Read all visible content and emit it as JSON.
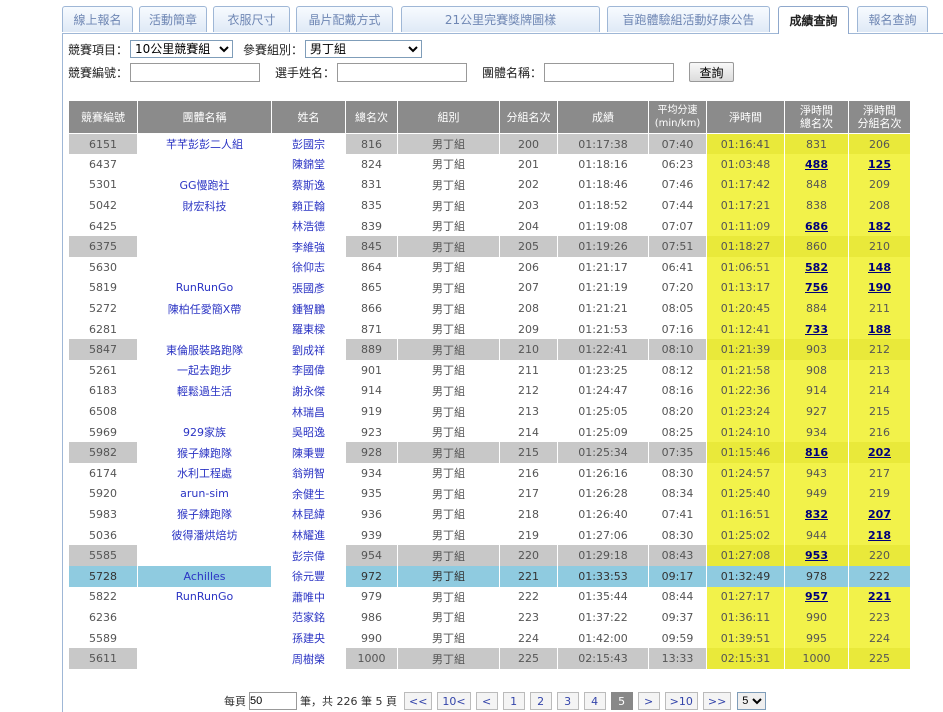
{
  "tabs": [
    "線上報名",
    "活動簡章",
    "衣服尺寸",
    "晶片配戴方式",
    "21公里完賽獎牌圖樣",
    "盲跑體驗組活動好康公告",
    "成績查詢",
    "報名查詢"
  ],
  "filters": {
    "event_label": "競賽項目：",
    "event_value": "10公里競賽組",
    "group_label": "參賽組別：",
    "group_value": "男丁組",
    "bib_label": "競賽編號：",
    "name_label": "選手姓名：",
    "team_label": "團體名稱：",
    "query_button": "查詢"
  },
  "table": {
    "headers": [
      "競賽編號",
      "團體名稱",
      "姓名",
      "總名次",
      "組別",
      "分組名次",
      "成績",
      "平均分速\n(min/km)",
      "淨時間",
      "淨時間\n總名次",
      "淨時間\n分組名次"
    ],
    "rows": [
      {
        "bib": "6151",
        "team": "芊芊彭彭二人組",
        "name": "彭國宗",
        "overall": "816",
        "group": "男丁組",
        "grank": "200",
        "result": "01:17:38",
        "pace": "07:40",
        "net": "01:16:41",
        "net_overall": "831",
        "net_grank": "206",
        "style": "gray"
      },
      {
        "bib": "6437",
        "team": "",
        "name": "陳錦堂",
        "overall": "824",
        "group": "男丁組",
        "grank": "201",
        "result": "01:18:16",
        "pace": "06:23",
        "net": "01:03:48",
        "net_overall": "488",
        "net_grank": "125",
        "style": "",
        "link": true
      },
      {
        "bib": "5301",
        "team": "GG慢跑社",
        "name": "蔡斯逸",
        "overall": "831",
        "group": "男丁組",
        "grank": "202",
        "result": "01:18:46",
        "pace": "07:46",
        "net": "01:17:42",
        "net_overall": "848",
        "net_grank": "209",
        "style": ""
      },
      {
        "bib": "5042",
        "team": "財宏科技",
        "name": "賴正翰",
        "overall": "835",
        "group": "男丁組",
        "grank": "203",
        "result": "01:18:52",
        "pace": "07:44",
        "net": "01:17:21",
        "net_overall": "838",
        "net_grank": "208",
        "style": ""
      },
      {
        "bib": "6425",
        "team": "",
        "name": "林浩德",
        "overall": "839",
        "group": "男丁組",
        "grank": "204",
        "result": "01:19:08",
        "pace": "07:07",
        "net": "01:11:09",
        "net_overall": "686",
        "net_grank": "182",
        "style": "",
        "link": true
      },
      {
        "bib": "6375",
        "team": "",
        "name": "李維強",
        "overall": "845",
        "group": "男丁組",
        "grank": "205",
        "result": "01:19:26",
        "pace": "07:51",
        "net": "01:18:27",
        "net_overall": "860",
        "net_grank": "210",
        "style": "gray"
      },
      {
        "bib": "5630",
        "team": "",
        "name": "徐仰志",
        "overall": "864",
        "group": "男丁組",
        "grank": "206",
        "result": "01:21:17",
        "pace": "06:41",
        "net": "01:06:51",
        "net_overall": "582",
        "net_grank": "148",
        "style": "",
        "link": true
      },
      {
        "bib": "5819",
        "team": "RunRunGo",
        "name": "張國彥",
        "overall": "865",
        "group": "男丁組",
        "grank": "207",
        "result": "01:21:19",
        "pace": "07:20",
        "net": "01:13:17",
        "net_overall": "756",
        "net_grank": "190",
        "style": "",
        "link": true
      },
      {
        "bib": "5272",
        "team": "陳柏任愛簡X帶",
        "name": "鍾智鵬",
        "overall": "866",
        "group": "男丁組",
        "grank": "208",
        "result": "01:21:21",
        "pace": "08:05",
        "net": "01:20:45",
        "net_overall": "884",
        "net_grank": "211",
        "style": ""
      },
      {
        "bib": "6281",
        "team": "",
        "name": "羅東樑",
        "overall": "871",
        "group": "男丁組",
        "grank": "209",
        "result": "01:21:53",
        "pace": "07:16",
        "net": "01:12:41",
        "net_overall": "733",
        "net_grank": "188",
        "style": "",
        "link": true
      },
      {
        "bib": "5847",
        "team": "東倫服裝路跑隊",
        "name": "劉成祥",
        "overall": "889",
        "group": "男丁組",
        "grank": "210",
        "result": "01:22:41",
        "pace": "08:10",
        "net": "01:21:39",
        "net_overall": "903",
        "net_grank": "212",
        "style": "gray"
      },
      {
        "bib": "5261",
        "team": "一起去跑步",
        "name": "李國偉",
        "overall": "901",
        "group": "男丁組",
        "grank": "211",
        "result": "01:23:25",
        "pace": "08:12",
        "net": "01:21:58",
        "net_overall": "908",
        "net_grank": "213",
        "style": ""
      },
      {
        "bib": "6183",
        "team": "輕鬆過生活",
        "name": "謝永傑",
        "overall": "914",
        "group": "男丁組",
        "grank": "212",
        "result": "01:24:47",
        "pace": "08:16",
        "net": "01:22:36",
        "net_overall": "914",
        "net_grank": "214",
        "style": ""
      },
      {
        "bib": "6508",
        "team": "",
        "name": "林瑞昌",
        "overall": "919",
        "group": "男丁組",
        "grank": "213",
        "result": "01:25:05",
        "pace": "08:20",
        "net": "01:23:24",
        "net_overall": "927",
        "net_grank": "215",
        "style": ""
      },
      {
        "bib": "5969",
        "team": "929家族",
        "name": "吳昭逸",
        "overall": "923",
        "group": "男丁組",
        "grank": "214",
        "result": "01:25:09",
        "pace": "08:25",
        "net": "01:24:10",
        "net_overall": "934",
        "net_grank": "216",
        "style": ""
      },
      {
        "bib": "5982",
        "team": "猴子練跑隊",
        "name": "陳秉豐",
        "overall": "928",
        "group": "男丁組",
        "grank": "215",
        "result": "01:25:34",
        "pace": "07:35",
        "net": "01:15:46",
        "net_overall": "816",
        "net_grank": "202",
        "style": "gray",
        "link": true
      },
      {
        "bib": "6174",
        "team": "水利工程處",
        "name": "翁朔智",
        "overall": "934",
        "group": "男丁組",
        "grank": "216",
        "result": "01:26:16",
        "pace": "08:30",
        "net": "01:24:57",
        "net_overall": "943",
        "net_grank": "217",
        "style": ""
      },
      {
        "bib": "5920",
        "team": "arun-sim",
        "name": "余健生",
        "overall": "935",
        "group": "男丁組",
        "grank": "217",
        "result": "01:26:28",
        "pace": "08:34",
        "net": "01:25:40",
        "net_overall": "949",
        "net_grank": "219",
        "style": ""
      },
      {
        "bib": "5983",
        "team": "猴子練跑隊",
        "name": "林昆緯",
        "overall": "936",
        "group": "男丁組",
        "grank": "218",
        "result": "01:26:40",
        "pace": "07:41",
        "net": "01:16:51",
        "net_overall": "832",
        "net_grank": "207",
        "style": "",
        "link": true
      },
      {
        "bib": "5036",
        "team": "彼得潘烘焙坊",
        "name": "林耀進",
        "overall": "939",
        "group": "男丁組",
        "grank": "219",
        "result": "01:27:06",
        "pace": "08:30",
        "net": "01:25:02",
        "net_overall": "944",
        "net_grank": "218",
        "style": "",
        "link2": true
      },
      {
        "bib": "5585",
        "team": "",
        "name": "彭宗偉",
        "overall": "954",
        "group": "男丁組",
        "grank": "220",
        "result": "01:29:18",
        "pace": "08:43",
        "net": "01:27:08",
        "net_overall": "953",
        "net_grank": "220",
        "style": "gray",
        "link1": true
      },
      {
        "bib": "5728",
        "team": "Achilles",
        "name": "徐元豐",
        "overall": "972",
        "group": "男丁組",
        "grank": "221",
        "result": "01:33:53",
        "pace": "09:17",
        "net": "01:32:49",
        "net_overall": "978",
        "net_grank": "222",
        "style": "blue"
      },
      {
        "bib": "5822",
        "team": "RunRunGo",
        "name": "蕭唯中",
        "overall": "979",
        "group": "男丁組",
        "grank": "222",
        "result": "01:35:44",
        "pace": "08:44",
        "net": "01:27:17",
        "net_overall": "957",
        "net_grank": "221",
        "style": "",
        "link": true
      },
      {
        "bib": "6236",
        "team": "",
        "name": "范家銘",
        "overall": "986",
        "group": "男丁組",
        "grank": "223",
        "result": "01:37:22",
        "pace": "09:37",
        "net": "01:36:11",
        "net_overall": "990",
        "net_grank": "223",
        "style": ""
      },
      {
        "bib": "5589",
        "team": "",
        "name": "孫建央",
        "overall": "990",
        "group": "男丁組",
        "grank": "224",
        "result": "01:42:00",
        "pace": "09:59",
        "net": "01:39:51",
        "net_overall": "995",
        "net_grank": "224",
        "style": ""
      },
      {
        "bib": "5611",
        "team": "",
        "name": "周樹榮",
        "overall": "1000",
        "group": "男丁組",
        "grank": "225",
        "result": "02:15:43",
        "pace": "13:33",
        "net": "02:15:31",
        "net_overall": "1000",
        "net_grank": "225",
        "style": "gray"
      }
    ]
  },
  "pager": {
    "per_page_label": "每頁",
    "per_page_value": "50",
    "summary": "筆，共 226 筆 5 頁",
    "buttons": [
      "<<",
      "10<",
      "<",
      "1",
      "2",
      "3",
      "4",
      "5",
      ">",
      ">10",
      ">>"
    ],
    "current": "5",
    "page_select": "5"
  }
}
